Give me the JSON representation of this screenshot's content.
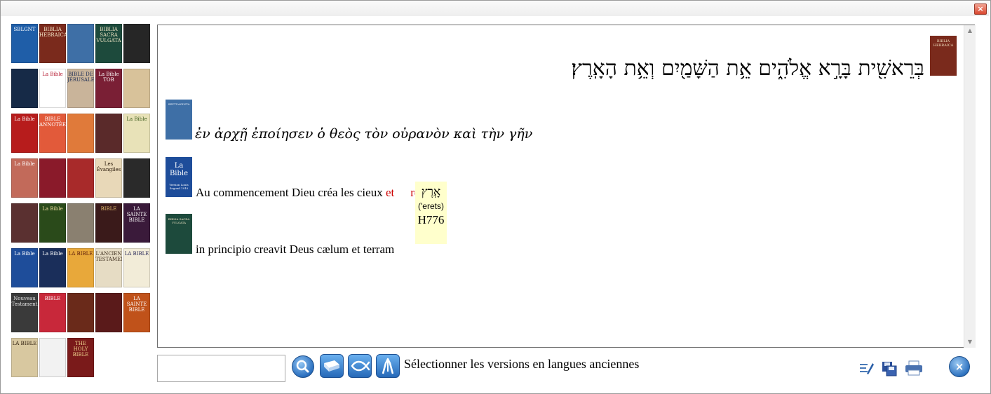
{
  "window": {
    "close_glyph": "×"
  },
  "shelf": {
    "covers": [
      {
        "label": "SBLGNT",
        "color": "#1f5ea8",
        "text_color": "#ffffff"
      },
      {
        "label": "BIBLIA HEBRAICA",
        "color": "#7a2a1c",
        "text_color": "#f5e6c8"
      },
      {
        "label": "",
        "color": "#3e6fa6",
        "text_color": "#ffffff"
      },
      {
        "label": "BIBLIA SACRA VULGATA",
        "color": "#1d4a3c",
        "text_color": "#e8e0c0"
      },
      {
        "label": "",
        "color": "#262626",
        "text_color": "#cfcfcf"
      },
      {
        "label": "",
        "color": "#162a47",
        "text_color": "#ffffff"
      },
      {
        "label": "La Bible",
        "color": "#ffffff",
        "text_color": "#b3122a"
      },
      {
        "label": "BIBLE DE JÉRUSALEM",
        "color": "#c9b49a",
        "text_color": "#1c2d55"
      },
      {
        "label": "La Bible TOB",
        "color": "#7a1f35",
        "text_color": "#ffffff"
      },
      {
        "label": "",
        "color": "#d8c29a",
        "text_color": "#5a3a1a"
      },
      {
        "label": "La Bible",
        "color": "#b71c1c",
        "text_color": "#ffffff"
      },
      {
        "label": "BIBLE ANNOTÉE",
        "color": "#e25a3a",
        "text_color": "#ffffff"
      },
      {
        "label": "",
        "color": "#e07a3a",
        "text_color": "#ffffff"
      },
      {
        "label": "",
        "color": "#5a2a2a",
        "text_color": "#e6d6a8"
      },
      {
        "label": "La Bible",
        "color": "#e8e2b8",
        "text_color": "#3a5a1a"
      },
      {
        "label": "La Bible",
        "color": "#c26a5a",
        "text_color": "#ffffff"
      },
      {
        "label": "",
        "color": "#8a1a2a",
        "text_color": "#ffffff"
      },
      {
        "label": "",
        "color": "#a82a2a",
        "text_color": "#ffffff"
      },
      {
        "label": "Les Évangiles",
        "color": "#e8d8b8",
        "text_color": "#2a1a0a"
      },
      {
        "label": "",
        "color": "#2a2a2a",
        "text_color": "#e6e6e6"
      },
      {
        "label": "",
        "color": "#5a3030",
        "text_color": "#d8c8a8"
      },
      {
        "label": "La Bible",
        "color": "#2a4a1a",
        "text_color": "#f0e0a0"
      },
      {
        "label": "",
        "color": "#8a8070",
        "text_color": "#ffffff"
      },
      {
        "label": "BIBLE",
        "color": "#3a1a1a",
        "text_color": "#e6c070"
      },
      {
        "label": "LA SAINTE BIBLE",
        "color": "#3a1a3a",
        "text_color": "#ffffff"
      },
      {
        "label": "La Bible",
        "color": "#1e4d9a",
        "text_color": "#ffffff"
      },
      {
        "label": "La Bible",
        "color": "#1a2e5a",
        "text_color": "#ffffff"
      },
      {
        "label": "LA BIBLE",
        "color": "#e8a83a",
        "text_color": "#5a1a0a"
      },
      {
        "label": "L'ANCIEN TESTAMENT",
        "color": "#e6dcc4",
        "text_color": "#3a2a1a"
      },
      {
        "label": "LA BIBLE",
        "color": "#f2ecd8",
        "text_color": "#2a2a5a"
      },
      {
        "label": "Nouveau Testament",
        "color": "#3a3a3a",
        "text_color": "#e6e6e6"
      },
      {
        "label": "BIBLE",
        "color": "#c8283a",
        "text_color": "#ffffff"
      },
      {
        "label": "",
        "color": "#6a2a1a",
        "text_color": "#e6c890"
      },
      {
        "label": "",
        "color": "#5a1a1a",
        "text_color": "#e6c890"
      },
      {
        "label": "LA SAINTE BIBLE",
        "color": "#c0521a",
        "text_color": "#ffffff"
      },
      {
        "label": "LA BIBLE",
        "color": "#d8c8a0",
        "text_color": "#2a1a0a"
      },
      {
        "label": "",
        "color": "#f2f2f2",
        "text_color": "#2a2a2a"
      },
      {
        "label": "THE HOLY BIBLE",
        "color": "#7a1a1a",
        "text_color": "#f0d890"
      }
    ]
  },
  "reader": {
    "hebrew": {
      "cover_color": "#7a2a1c",
      "cover_label": "BIBLIA HEBRAICA",
      "text": "בְּרֵאשִׁ֖ית בָּרָ֣א אֱלֹהִ֑ים אֵ֥ת הַשָּׁמַ֖יִם וְאֵ֥ת הָאָֽרֶץ׃"
    },
    "greek": {
      "cover_color": "#3e6fa6",
      "cover_label": "SEPTUAGINTA",
      "text": "ἐν ἀρχῇ ἐποίησεν ὁ θεὸς τὸν οὐρανὸν καὶ τὴν γῆν"
    },
    "french": {
      "cover_color": "#1e4d9a",
      "cover_label": "La Bible",
      "cover_sublabel": "Version Louis Segond 1910",
      "text_plain": "Au commencement Dieu créa les cieux ",
      "text_highlight_a": "et",
      "text_highlight_b": "re"
    },
    "latin": {
      "cover_color": "#1d4a3c",
      "cover_label": "BIBLIA SACRA VULGATA",
      "text": "in principio creavit Deus cælum et terram"
    },
    "tooltip": {
      "hebrew": "אָֽרֶץ",
      "transliteration": "('erets)",
      "strong": "H776"
    }
  },
  "bottom": {
    "search_value": "",
    "status_label": "Sélectionner les versions en langues anciennes",
    "close_glyph": "×"
  }
}
